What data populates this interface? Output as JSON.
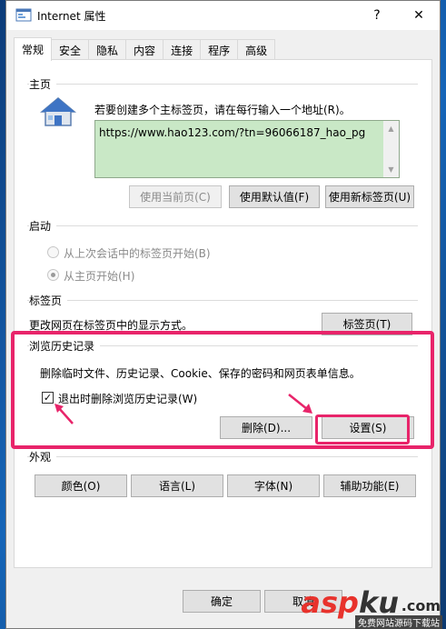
{
  "window": {
    "title": "Internet 属性",
    "help_symbol": "?",
    "close_symbol": "✕"
  },
  "tabs": [
    "常规",
    "安全",
    "隐私",
    "内容",
    "连接",
    "程序",
    "高级"
  ],
  "homepage": {
    "section_label": "主页",
    "instruction": "若要创建多个主标签页，请在每行输入一个地址(R)。",
    "url": "https://www.hao123.com/?tn=96066187_hao_pg",
    "buttons": {
      "use_current": "使用当前页(C)",
      "use_default": "使用默认值(F)",
      "use_new_tab": "使用新标签页(U)"
    }
  },
  "startup": {
    "section_label": "启动",
    "option_last_session": "从上次会话中的标签页开始(B)",
    "option_homepage": "从主页开始(H)"
  },
  "tabs_section": {
    "section_label": "标签页",
    "description": "更改网页在标签页中的显示方式。",
    "button": "标签页(T)"
  },
  "history": {
    "section_label": "浏览历史记录",
    "description": "删除临时文件、历史记录、Cookie、保存的密码和网页表单信息。",
    "checkbox_label": "退出时删除浏览历史记录(W)",
    "checkbox_checked": true,
    "delete_button": "删除(D)...",
    "settings_button": "设置(S)"
  },
  "appearance": {
    "section_label": "外观",
    "colors": "颜色(O)",
    "languages": "语言(L)",
    "fonts": "字体(N)",
    "accessibility": "辅助功能(E)"
  },
  "footer": {
    "ok": "确定",
    "cancel": "取消"
  },
  "watermark": {
    "brand_asp": "asp",
    "brand_ku": "ku",
    "brand_suffix": ".com",
    "tagline": "免费网站源码下载站"
  },
  "annotation_color": "#e8246a"
}
